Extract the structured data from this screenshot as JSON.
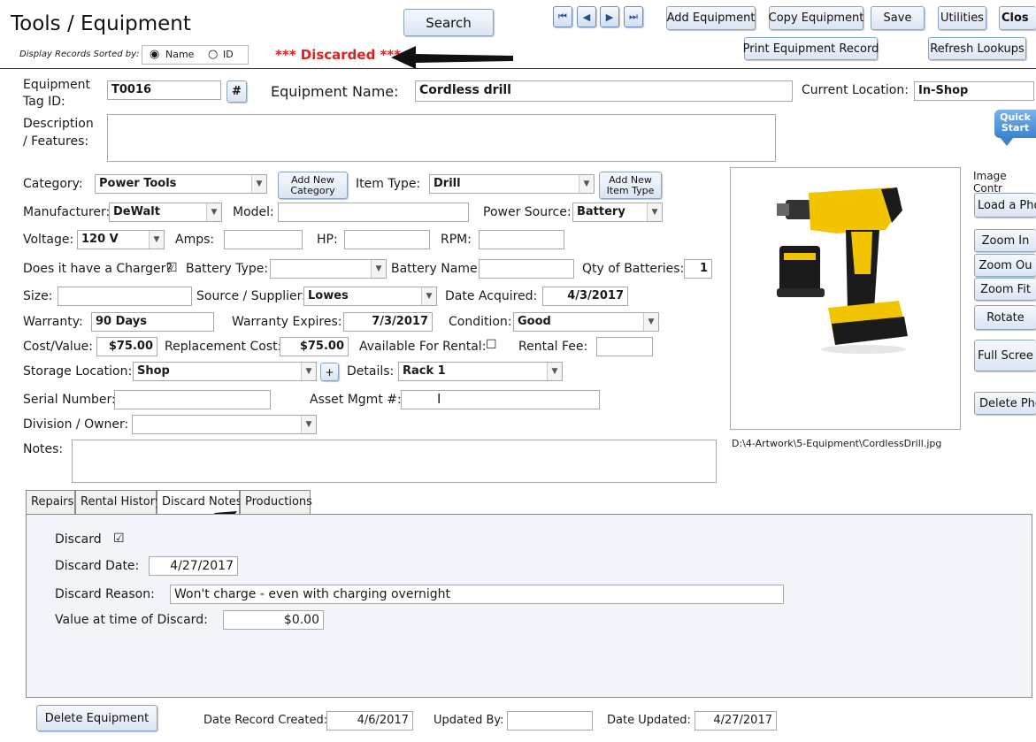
{
  "header": {
    "title": "Tools / Equipment",
    "sort_label": "Display Records Sorted by:",
    "sort_name": "Name",
    "sort_id": "ID",
    "status": "*** Discarded ***",
    "search": "Search",
    "nav": {
      "first": "⏮",
      "prev": "◀",
      "next": "▶",
      "last": "⏭"
    },
    "add_equipment": "Add Equipment",
    "copy_equipment": "Copy Equipment",
    "save": "Save",
    "utilities": "Utilities",
    "close": "Clos",
    "print_record": "Print Equipment Record",
    "refresh_lookups": "Refresh Lookups"
  },
  "form": {
    "tag_id_label_1": "Equipment",
    "tag_id_label_2": "Tag ID:",
    "tag_id": "T0016",
    "hash_button": "#",
    "name_label": "Equipment Name:",
    "name": "Cordless drill",
    "location_label": "Current Location:",
    "location": "In-Shop",
    "description_label_1": "Description",
    "description_label_2": "/ Features:",
    "description": "",
    "category_label": "Category:",
    "category": "Power Tools",
    "add_category": "Add New Category",
    "item_type_label": "Item Type:",
    "item_type": "Drill",
    "add_item_type": "Add New Item Type",
    "manufacturer_label": "Manufacturer:",
    "manufacturer": "DeWalt",
    "model_label": "Model:",
    "model": "",
    "power_source_label": "Power Source:",
    "power_source": "Battery",
    "voltage_label": "Voltage:",
    "voltage": "120 V",
    "amps_label": "Amps:",
    "hp_label": "HP:",
    "rpm_label": "RPM:",
    "charger_label": "Does it have a Charger?",
    "battery_type_label": "Battery Type:",
    "battery_name_label": "Battery Name:",
    "qty_batteries_label": "Qty of Batteries:",
    "qty_batteries": "1",
    "size_label": "Size:",
    "source_label": "Source / Supplier:",
    "source": "Lowes",
    "date_acquired_label": "Date Acquired:",
    "date_acquired": "4/3/2017",
    "warranty_label": "Warranty:",
    "warranty": "90 Days",
    "warranty_expires_label": "Warranty Expires:",
    "warranty_expires": "7/3/2017",
    "condition_label": "Condition:",
    "condition": "Good",
    "cost_label": "Cost/Value:",
    "cost": "$75.00",
    "replacement_label": "Replacement Cost:",
    "replacement": "$75.00",
    "rental_avail_label": "Available For Rental:",
    "rental_fee_label": "Rental Fee:",
    "storage_label": "Storage Location:",
    "storage": "Shop",
    "plus_button": "+",
    "details_label": "Details:",
    "details": "Rack 1",
    "serial_label": "Serial Number:",
    "asset_label": "Asset Mgmt #:",
    "division_label": "Division / Owner:",
    "notes_label": "Notes:"
  },
  "image_panel": {
    "quick_start": "Quick Start",
    "controls_label": "Image Contr",
    "load_photo": "Load a Pho",
    "zoom_in": "Zoom In",
    "zoom_out": "Zoom Ou",
    "zoom_fit": "Zoom Fit",
    "rotate": "Rotate",
    "full_screen": "Full Scree",
    "delete_photo": "Delete Pho",
    "path": "D:\\4-Artwork\\5-Equipment\\CordlessDrill.jpg"
  },
  "tabs": [
    {
      "label": "Repairs"
    },
    {
      "label": "Rental History"
    },
    {
      "label": "Discard Notes"
    },
    {
      "label": "Productions"
    }
  ],
  "discard": {
    "discard_label": "Discard",
    "date_label": "Discard Date:",
    "date": "4/27/2017",
    "reason_label": "Discard Reason:",
    "reason": "Won't charge - even with charging overnight",
    "value_label": "Value at time of Discard:",
    "value": "$0.00"
  },
  "footer": {
    "delete_equipment": "Delete Equipment",
    "created_label": "Date Record Created:",
    "created": "4/6/2017",
    "updated_by_label": "Updated By:",
    "updated_by": "",
    "updated_label": "Date Updated:",
    "updated": "4/27/2017"
  },
  "colors": {
    "status_red": "#e02020",
    "accent_blue": "#2a4e8a"
  }
}
